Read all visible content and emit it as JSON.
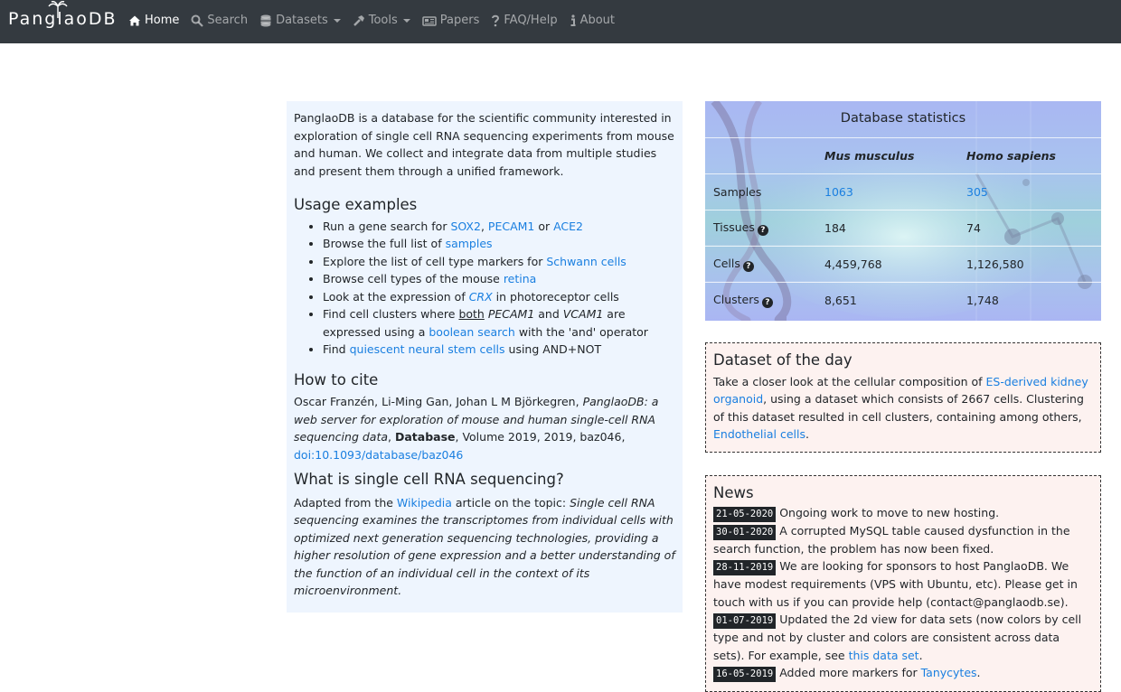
{
  "nav": {
    "brand": "PanglaoDB",
    "items": [
      {
        "label": "Home",
        "icon": "home-icon"
      },
      {
        "label": "Search",
        "icon": "search-icon"
      },
      {
        "label": "Datasets",
        "icon": "database-icon"
      },
      {
        "label": "Tools",
        "icon": "wrench-icon"
      },
      {
        "label": "Papers",
        "icon": "newspaper-icon"
      },
      {
        "label": "FAQ/Help",
        "icon": "question-icon"
      },
      {
        "label": "About",
        "icon": "info-icon"
      }
    ]
  },
  "intro": {
    "text": "PanglaoDB is a database for the scientific community interested in exploration of single cell RNA sequencing experiments from mouse and human. We collect and integrate data from multiple studies and present them through a unified framework."
  },
  "usage": {
    "title": "Usage examples",
    "items": [
      {
        "pre": "Run a gene search for ",
        "l1": "SOX2",
        "m1": ", ",
        "l2": "PECAM1",
        "m2": " or ",
        "l3": "ACE2"
      },
      {
        "pre": "Browse the full list of ",
        "link": "samples"
      },
      {
        "pre": "Explore the list of cell type markers for ",
        "link": "Schwann cells"
      },
      {
        "pre": "Browse cell types of the mouse ",
        "link": "retina"
      },
      {
        "pre": "Look at the expression of ",
        "link": "CRX",
        "post": " in photoreceptor cells"
      },
      {
        "pre": "Find cell clusters where ",
        "u": "both",
        "sp": " ",
        "em1": "PECAM1",
        "m": " and ",
        "em2": "VCAM1",
        "post1": " are expressed using a ",
        "link": "boolean search",
        "post2": " with the 'and' operator"
      },
      {
        "pre": "Find ",
        "link": "quiescent neural stem cells",
        "post": " using AND+NOT"
      }
    ]
  },
  "cite": {
    "title": "How to cite",
    "authors": "Oscar Franzén, Li-Ming Gan, Johan L M Björkegren, ",
    "paper_title": "PanglaoDB: a web server for exploration of mouse and human single-cell RNA sequencing data",
    "sep": ", ",
    "journal": "Database",
    "rest": ", Volume 2019, 2019, baz046,",
    "doi": "doi:10.1093/database/baz046"
  },
  "what": {
    "title": "What is single cell RNA sequencing?",
    "pre": "Adapted from the ",
    "link": "Wikipedia",
    "mid": " article on the topic: ",
    "quote": "Single cell RNA sequencing examines the transcriptomes from individual cells with optimized next generation sequencing technologies, providing a higher resolution of gene expression and a better understanding of the function of an individual cell in the context of its microenvironment."
  },
  "stats": {
    "title": "Database statistics",
    "col1": "Mus musculus",
    "col2": "Homo sapiens",
    "rows": [
      {
        "label": "Samples",
        "mouse": "1063",
        "human": "305"
      },
      {
        "label": "Tissues",
        "mouse": "184",
        "human": "74"
      },
      {
        "label": "Cells",
        "mouse": "4,459,768",
        "human": "1,126,580"
      },
      {
        "label": "Clusters",
        "mouse": "8,651",
        "human": "1,748"
      }
    ],
    "help": "?"
  },
  "dotd": {
    "title": "Dataset of the day",
    "pre": "Take a closer look at the cellular composition of ",
    "link1": "ES-derived kidney organoid",
    "mid": ", using a dataset which consists of 2667 cells. Clustering of this dataset resulted in cell clusters, containing among others, ",
    "link2": "Endothelial cells",
    "post": "."
  },
  "news": {
    "title": "News",
    "items": [
      {
        "date": "21-05-2020",
        "text": "Ongoing work to move to new hosting."
      },
      {
        "date": "30-01-2020",
        "text": "A corrupted MySQL table caused dysfunction in the search function, the problem has now been fixed."
      },
      {
        "date": "28-11-2019",
        "text": "We are looking for sponsors to host PanglaoDB. We have modest requirements (VPS with Ubuntu, etc). Please get in touch with us if you can provide help (contact@panglaodb.se)."
      },
      {
        "date": "01-07-2019",
        "text": "Updated the 2d view for data sets (now colors by cell type and not by cluster and colors are consistent across data sets). For example, see ",
        "link": "this data set",
        "post": "."
      },
      {
        "date": "16-05-2019",
        "text": "Added more markers for ",
        "link": "Tanycytes",
        "post": "."
      }
    ]
  },
  "colors": {
    "navbar": "#343a40",
    "link": "#1a7fe0",
    "intro_bg": "#eef5fe",
    "news_bg": "#fdf2f0"
  }
}
